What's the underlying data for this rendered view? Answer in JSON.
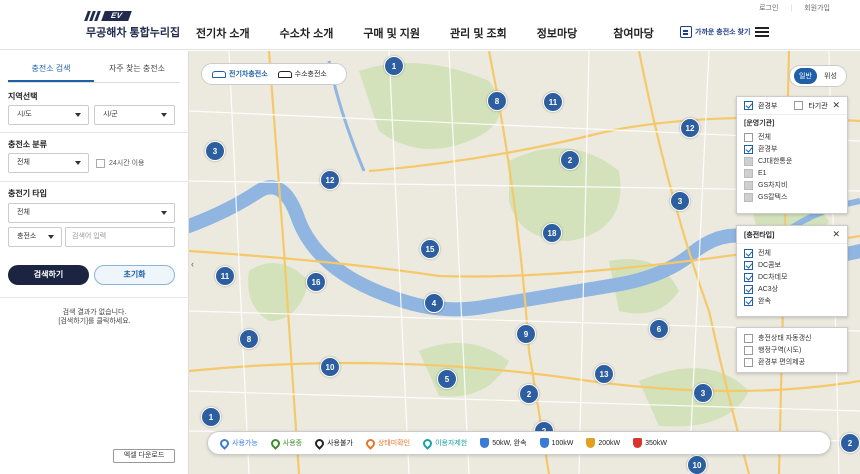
{
  "header": {
    "logo_badge": "EV",
    "logo_text": "무공해차 통합누리집",
    "top_links": [
      "로그인",
      "회원가입"
    ],
    "nav": [
      "전기차 소개",
      "수소차 소개",
      "구매 및 지원",
      "관리 및 조회",
      "정보마당",
      "참여마당"
    ],
    "finder_label": "가까운 충전소 찾기"
  },
  "sidebar": {
    "tabs": [
      "충전소 검색",
      "자주 찾는 충전소"
    ],
    "region_label": "지역선택",
    "region_sido": "시/도",
    "region_sigun": "시/군",
    "station_type_label": "충전소 분류",
    "station_type_value": "전체",
    "open24_label": "24시간 이용",
    "charger_type_label": "충전기 타입",
    "charger_type_value": "전체",
    "search_field_select": "충전소",
    "search_placeholder": "검색어 입력",
    "search_button": "검색하기",
    "reset_button": "초기화",
    "empty_line1": "검색 결과가 없습니다.",
    "empty_line2": "[검색하기]를 클릭하세요.",
    "excel_button": "엑셀 다운로드"
  },
  "map": {
    "mode_ev": "전기차충전소",
    "mode_h2": "수소충전소",
    "view_normal": "일반",
    "view_satellite": "위성",
    "markers": [
      "1",
      "8",
      "11",
      "3",
      "12",
      "2",
      "12",
      "3",
      "18",
      "15",
      "16",
      "11",
      "4",
      "8",
      "9",
      "6",
      "10",
      "5",
      "13",
      "2",
      "3",
      "1",
      "2",
      "10",
      "2"
    ]
  },
  "operator_panel": {
    "tab_ministry": "환경부",
    "tab_other": "타기관",
    "title": "[운영기관]",
    "items": [
      {
        "label": "전체",
        "state": "off"
      },
      {
        "label": "환경부",
        "state": "on"
      },
      {
        "label": "CJ대한통운",
        "state": "grey"
      },
      {
        "label": "E1",
        "state": "grey"
      },
      {
        "label": "GS차지비",
        "state": "grey"
      },
      {
        "label": "GS칼텍스",
        "state": "grey"
      }
    ]
  },
  "charger_panel": {
    "title": "[충전타입]",
    "items": [
      {
        "label": "전체",
        "state": "on"
      },
      {
        "label": "DC콤보",
        "state": "on"
      },
      {
        "label": "DC차데모",
        "state": "on"
      },
      {
        "label": "AC3상",
        "state": "on"
      },
      {
        "label": "완속",
        "state": "on"
      }
    ]
  },
  "option_panel": {
    "items": [
      "충전상태 자동갱신",
      "행정구역(시도)",
      "환경부 편의제공"
    ]
  },
  "legend": [
    {
      "label": "사용가능",
      "color": "#3a7bd5",
      "kind": "pin"
    },
    {
      "label": "사용중",
      "color": "#3f8c2a",
      "kind": "pin"
    },
    {
      "label": "사용불가",
      "color": "#222222",
      "kind": "pin"
    },
    {
      "label": "상태미확인",
      "color": "#e8742a",
      "kind": "pin"
    },
    {
      "label": "이용자제한",
      "color": "#19a3a3",
      "kind": "pin"
    },
    {
      "label": "50kW, 완속",
      "color": "#3a7bd5",
      "kind": "shield"
    },
    {
      "label": "100kW",
      "color": "#3a7bd5",
      "kind": "shield"
    },
    {
      "label": "200kW",
      "color": "#e0a020",
      "kind": "shield"
    },
    {
      "label": "350kW",
      "color": "#d8342c",
      "kind": "shield"
    }
  ],
  "colors": {
    "brand": "#1b2440",
    "accent": "#1e5fa8",
    "marker": "#2d5fa0",
    "river": "#8fb5e0",
    "park": "#cfe0b5"
  }
}
